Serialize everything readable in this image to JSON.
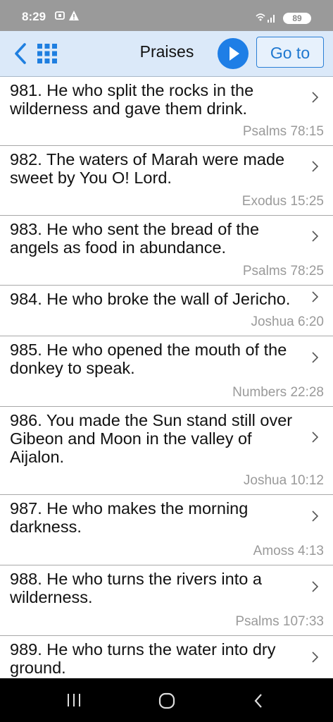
{
  "status": {
    "time": "8:29",
    "battery": "89"
  },
  "toolbar": {
    "title": "Praises",
    "goto_label": "Go to"
  },
  "items": [
    {
      "text": "981. He who split the rocks in the wilderness and gave them drink.",
      "ref": "Psalms 78:15"
    },
    {
      "text": "982. The waters of Marah were made sweet by You O! Lord.",
      "ref": "Exodus 15:25"
    },
    {
      "text": "983. He who sent the bread of the angels as food in abundance.",
      "ref": "Psalms 78:25"
    },
    {
      "text": "984. He who broke the wall of Jericho.",
      "ref": "Joshua 6:20"
    },
    {
      "text": "985. He who opened the mouth of the donkey to speak.",
      "ref": "Numbers 22:28"
    },
    {
      "text": "986. You made the Sun stand still over Gibeon and Moon in the valley of Aijalon.",
      "ref": "Joshua 10:12"
    },
    {
      "text": "987. He who makes the morning darkness.",
      "ref": "Amoss 4:13"
    },
    {
      "text": "988. He who turns the rivers into a wilderness.",
      "ref": "Psalms 107:33"
    },
    {
      "text": "989. He who turns the water into dry ground.",
      "ref": ""
    }
  ]
}
